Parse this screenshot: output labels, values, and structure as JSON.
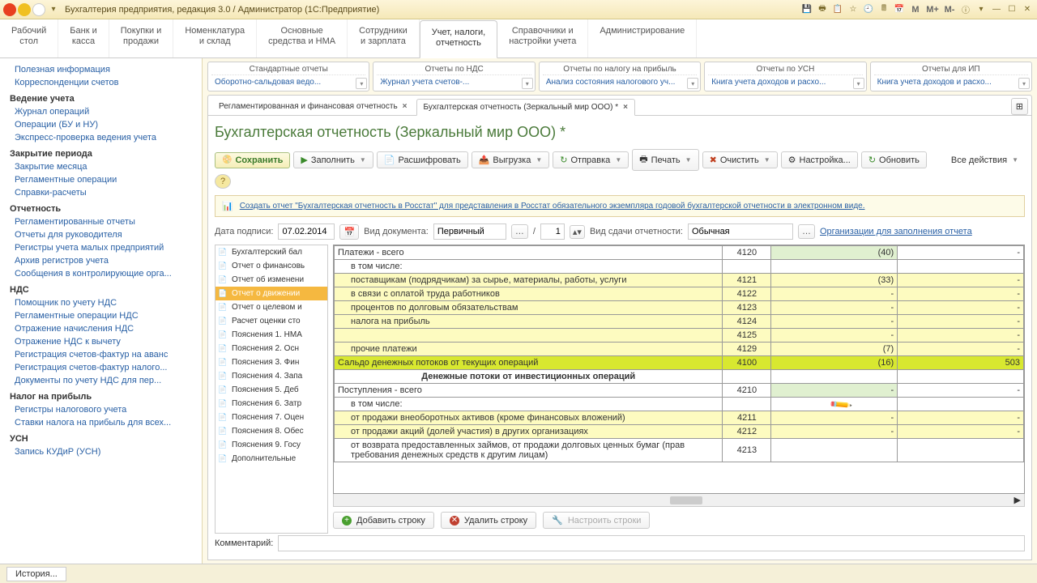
{
  "title": "Бухгалтерия предприятия, редакция 3.0 / Администратор  (1С:Предприятие)",
  "m_buttons": [
    "M",
    "M+",
    "M-"
  ],
  "nav_tabs": [
    {
      "l1": "Рабочий",
      "l2": "стол"
    },
    {
      "l1": "Банк и",
      "l2": "касса"
    },
    {
      "l1": "Покупки и",
      "l2": "продажи"
    },
    {
      "l1": "Номенклатура",
      "l2": "и склад"
    },
    {
      "l1": "Основные",
      "l2": "средства и НМА"
    },
    {
      "l1": "Сотрудники",
      "l2": "и зарплата"
    },
    {
      "l1": "Учет, налоги,",
      "l2": "отчетность"
    },
    {
      "l1": "Справочники и",
      "l2": "настройки учета"
    },
    {
      "l1": "Администрирование",
      "l2": ""
    }
  ],
  "active_tab": 6,
  "sidebar": [
    {
      "type": "i",
      "label": "Полезная информация"
    },
    {
      "type": "i",
      "label": "Корреспонденции счетов"
    },
    {
      "type": "h",
      "label": "Ведение учета"
    },
    {
      "type": "i",
      "label": "Журнал операций"
    },
    {
      "type": "i",
      "label": "Операции (БУ и НУ)"
    },
    {
      "type": "i",
      "label": "Экспресс-проверка ведения учета"
    },
    {
      "type": "h",
      "label": "Закрытие периода"
    },
    {
      "type": "i",
      "label": "Закрытие месяца"
    },
    {
      "type": "i",
      "label": "Регламентные операции"
    },
    {
      "type": "i",
      "label": "Справки-расчеты"
    },
    {
      "type": "h",
      "label": "Отчетность"
    },
    {
      "type": "i",
      "label": "Регламентированные отчеты"
    },
    {
      "type": "i",
      "label": "Отчеты для руководителя"
    },
    {
      "type": "i",
      "label": "Регистры учета малых предприятий"
    },
    {
      "type": "i",
      "label": "Архив регистров учета"
    },
    {
      "type": "i",
      "label": "Сообщения в контролирующие орга..."
    },
    {
      "type": "h",
      "label": "НДС"
    },
    {
      "type": "i",
      "label": "Помощник по учету НДС"
    },
    {
      "type": "i",
      "label": "Регламентные операции НДС"
    },
    {
      "type": "i",
      "label": "Отражение начисления НДС"
    },
    {
      "type": "i",
      "label": "Отражение НДС к вычету"
    },
    {
      "type": "i",
      "label": "Регистрация счетов-фактур на аванс"
    },
    {
      "type": "i",
      "label": "Регистрация счетов-фактур налого..."
    },
    {
      "type": "i",
      "label": "Документы по учету НДС для пер..."
    },
    {
      "type": "h",
      "label": "Налог на прибыль"
    },
    {
      "type": "i",
      "label": "Регистры налогового учета"
    },
    {
      "type": "i",
      "label": "Ставки налога на прибыль для всех..."
    },
    {
      "type": "h",
      "label": "УСН"
    },
    {
      "type": "i",
      "label": "Запись КУДиР (УСН)"
    }
  ],
  "rpt_cats": [
    {
      "h": "Стандартные отчеты",
      "b": "Оборотно-сальдовая ведо..."
    },
    {
      "h": "Отчеты по НДС",
      "b": "Журнал учета счетов-..."
    },
    {
      "h": "Отчеты по налогу на прибыль",
      "b": "Анализ состояния налогового уч..."
    },
    {
      "h": "Отчеты по УСН",
      "b": "Книга учета доходов и расхо..."
    },
    {
      "h": "Отчеты для ИП",
      "b": "Книга учета доходов и расхо..."
    }
  ],
  "doc_tabs": [
    {
      "label": "Регламентированная и финансовая отчетность",
      "act": false
    },
    {
      "label": "Бухгалтерская отчетность (Зеркальный мир ООО) *",
      "act": true
    }
  ],
  "doc_title": "Бухгалтерская отчетность (Зеркальный мир ООО) *",
  "toolbar": {
    "save": "Сохранить",
    "fill": "Заполнить",
    "decode": "Расшифровать",
    "export": "Выгрузка",
    "send": "Отправка",
    "print": "Печать",
    "clear": "Очистить",
    "setup": "Настройка...",
    "refresh": "Обновить",
    "all": "Все действия"
  },
  "info_link": "Создать отчет \"Бухгалтерская отчетность в Росстат\" для представления в Росстат обязательного экземпляра годовой бухгалтерской отчетности в электронном виде.",
  "params": {
    "date_label": "Дата подписи:",
    "date": "07.02.2014",
    "doctype_label": "Вид документа:",
    "doctype": "Первичный",
    "sep": "/",
    "num": "1",
    "submit_label": "Вид сдачи отчетности:",
    "submit": "Обычная",
    "org_link": "Организации для заполнения отчета"
  },
  "reptree": [
    {
      "label": "Бухгалтерский бал",
      "sel": false
    },
    {
      "label": "Отчет о финансовь",
      "sel": false
    },
    {
      "label": "Отчет об изменени",
      "sel": false
    },
    {
      "label": "Отчет о движении",
      "sel": true
    },
    {
      "label": "Отчет о целевом и",
      "sel": false
    },
    {
      "label": "Расчет оценки сто",
      "sel": false
    },
    {
      "label": "Пояснения 1. НМА",
      "sel": false
    },
    {
      "label": "Пояснения 2. Осн",
      "sel": false
    },
    {
      "label": "Пояснения 3. Фин",
      "sel": false
    },
    {
      "label": "Пояснения 4. Запа",
      "sel": false
    },
    {
      "label": "Пояснения 5. Деб",
      "sel": false
    },
    {
      "label": "Пояснения 6. Затр",
      "sel": false
    },
    {
      "label": "Пояснения 7. Оцен",
      "sel": false
    },
    {
      "label": "Пояснения 8. Обес",
      "sel": false
    },
    {
      "label": "Пояснения 9. Госу",
      "sel": false
    },
    {
      "label": "Дополнительные"
    }
  ],
  "grid": [
    {
      "name": "Платежи - всего",
      "code": "4120",
      "v1": "(40)",
      "v2": "-",
      "cls": "r-grn",
      "ind": 0
    },
    {
      "name": "в том числе:",
      "code": "",
      "v1": "",
      "v2": "",
      "ind": 1
    },
    {
      "name": "поставщикам (подрядчикам) за сырье, материалы, работы, услуги",
      "code": "4121",
      "v1": "(33)",
      "v2": "-",
      "cls": "r-yel",
      "ind": 1
    },
    {
      "name": "в связи с оплатой труда работников",
      "code": "4122",
      "v1": "-",
      "v2": "-",
      "cls": "r-yel",
      "ind": 1
    },
    {
      "name": "процентов по долговым обязательствам",
      "code": "4123",
      "v1": "-",
      "v2": "-",
      "cls": "r-yel",
      "ind": 1
    },
    {
      "name": "налога на прибыль",
      "code": "4124",
      "v1": "-",
      "v2": "-",
      "cls": "r-yel",
      "ind": 1
    },
    {
      "name": "",
      "code": "4125",
      "v1": "-",
      "v2": "-",
      "cls": "r-yel",
      "ind": 1
    },
    {
      "name": "прочие платежи",
      "code": "4129",
      "v1": "(7)",
      "v2": "-",
      "cls": "r-yel",
      "ind": 1
    },
    {
      "name": "Сальдо денежных потоков от текущих операций",
      "code": "4100",
      "v1": "(16)",
      "v2": "503",
      "cls": "r-lime",
      "ind": 0
    },
    {
      "name": "Денежные потоки от инвестиционных операций",
      "code": "",
      "v1": "",
      "v2": "",
      "cls": "r-head",
      "ind": 0
    },
    {
      "name": "Поступления - всего",
      "code": "4210",
      "v1": "-",
      "v2": "-",
      "cls": "r-grn",
      "ind": 0
    },
    {
      "name": "в том числе:",
      "code": "",
      "v1": "",
      "v2": "",
      "ind": 1
    },
    {
      "name": "от продажи внеоборотных активов (кроме финансовых вложений)",
      "code": "4211",
      "v1": "-",
      "v2": "-",
      "cls": "r-yel",
      "ind": 1
    },
    {
      "name": "от продажи акций (долей участия) в других организациях",
      "code": "4212",
      "v1": "-",
      "v2": "-",
      "cls": "r-yel",
      "ind": 1
    },
    {
      "name": "от возврата предоставленных займов, от продажи долговых ценных бумаг (прав требования денежных средств к другим лицам)",
      "code": "4213",
      "v1": "",
      "v2": "",
      "ind": 1
    }
  ],
  "rowbtns": {
    "add": "Добавить строку",
    "del": "Удалить строку",
    "cfg": "Настроить строки"
  },
  "comment_label": "Комментарий:",
  "status_btn": "История..."
}
